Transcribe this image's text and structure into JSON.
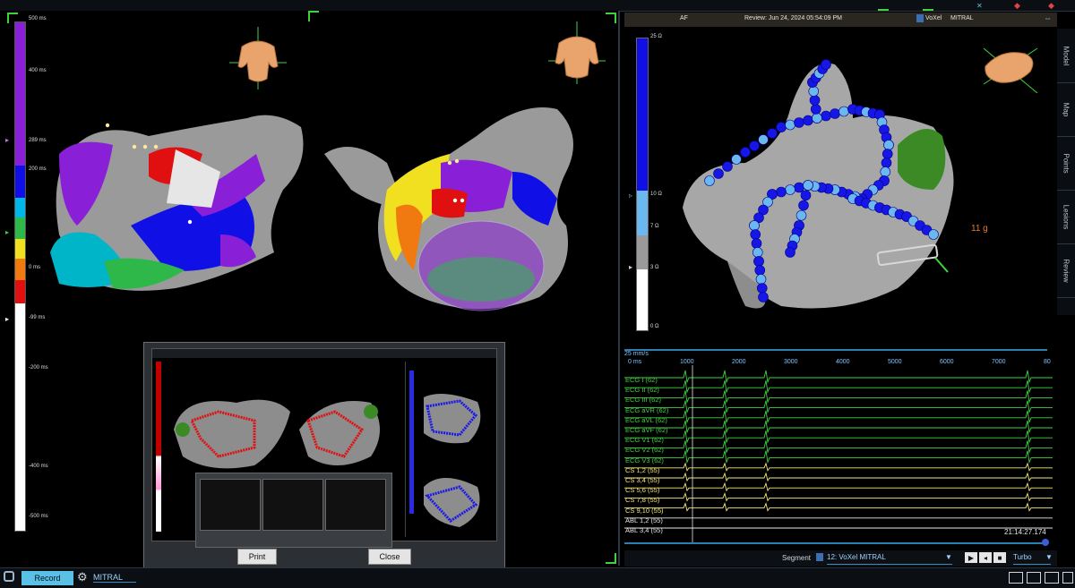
{
  "colors": {
    "accent": "#5bc0e6",
    "purple": "#8a1fd8",
    "blue": "#1010e6",
    "ecg_green": "#3fd23f",
    "cs_yellow": "#f4e67a",
    "gray": "#9a9a9a"
  },
  "left_panel": {
    "scale_labels": [
      "500 ms",
      "400 ms",
      "289 ms",
      "200 ms",
      "0 ms",
      "-99 ms",
      "-200 ms",
      "-400 ms",
      "-500 ms"
    ]
  },
  "right_panel": {
    "header": {
      "mode": "AF",
      "review": "Review: Jun 24, 2024 05:54:09 PM",
      "brand": "VoXel",
      "map": "MITRAL"
    },
    "force_scale_labels": [
      "25 Ω",
      "10 Ω",
      "7 Ω",
      "3 Ω",
      "0 Ω"
    ],
    "force_readout": "11 g",
    "tabs": [
      "Model",
      "Map",
      "Points",
      "Lesions",
      "Review"
    ],
    "timeline": {
      "speed": "25 mm/s",
      "ticks": [
        "0 ms",
        "1000",
        "2000",
        "3000",
        "4000",
        "5000",
        "6000",
        "7000",
        "80"
      ]
    },
    "channels": [
      "ECG I (62)",
      "ECG II (62)",
      "ECG III (62)",
      "ECG aVR (62)",
      "ECG aVL (62)",
      "ECG aVF (62)",
      "ECG V1 (62)",
      "ECG V2 (62)",
      "ECG V3 (62)",
      "CS 1,2 (55)",
      "CS 3,4 (55)",
      "CS 5,6 (55)",
      "CS 7,8 (55)",
      "CS 9,10 (55)",
      "ABL 1,2 (55)",
      "ABL 3,4 (55)"
    ],
    "timestamp": "21:14:27.174",
    "segment_label": "Segment",
    "segment_value": "12: VoXel MITRAL",
    "speed_select": "Turbo"
  },
  "dialog": {
    "print_label": "Print",
    "close_label": "Close"
  },
  "bottom": {
    "record_label": "Record",
    "map_name": "MITRAL"
  }
}
